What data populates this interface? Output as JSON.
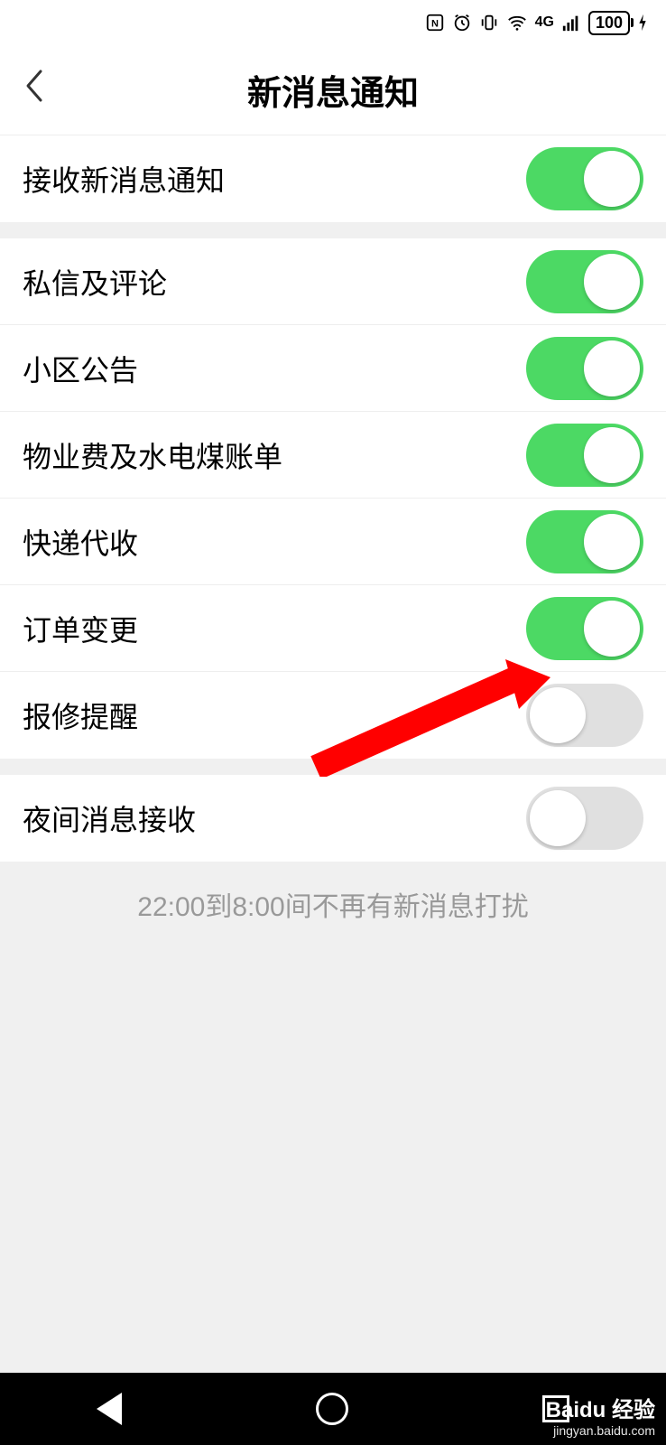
{
  "status_bar": {
    "nfc": "N",
    "alarm": "⏰",
    "vibrate": "📳",
    "wifi": "📶",
    "network": "4G",
    "signal": "📶",
    "battery": "100",
    "charging": "⚡"
  },
  "header": {
    "title": "新消息通知"
  },
  "groups": [
    {
      "items": [
        {
          "label": "接收新消息通知",
          "on": true
        }
      ]
    },
    {
      "items": [
        {
          "label": "私信及评论",
          "on": true
        },
        {
          "label": "小区公告",
          "on": true
        },
        {
          "label": "物业费及水电煤账单",
          "on": true
        },
        {
          "label": "快递代收",
          "on": true
        },
        {
          "label": "订单变更",
          "on": true
        },
        {
          "label": "报修提醒",
          "on": false
        }
      ]
    },
    {
      "items": [
        {
          "label": "夜间消息接收",
          "on": false
        }
      ]
    }
  ],
  "footer_note": "22:00到8:00间不再有新消息打扰",
  "colors": {
    "toggle_on": "#4cd964",
    "toggle_off": "#e0e0e0",
    "arrow": "#ff0000"
  },
  "watermark": {
    "brand": "Baidu 经验",
    "url": "jingyan.baidu.com"
  }
}
